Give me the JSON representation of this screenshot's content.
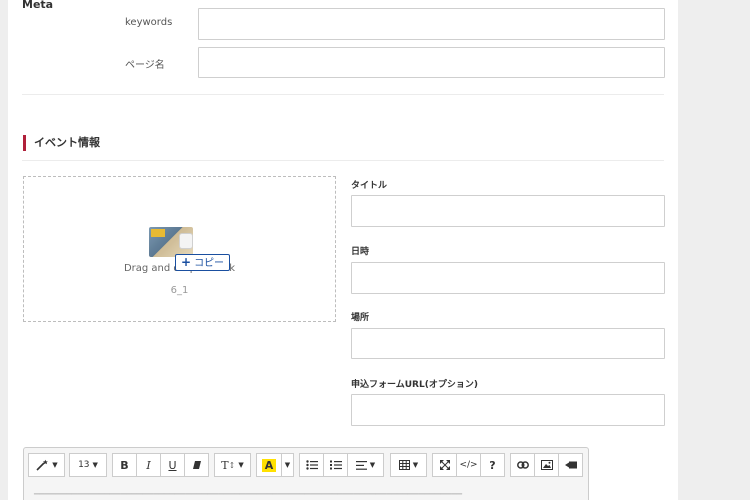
{
  "meta": {
    "section_label": "Meta",
    "keywords_label": "keywords",
    "page_name_label": "ページ名"
  },
  "event": {
    "section_title": "イベント情報",
    "accent_color": "#b0203a",
    "dropzone": {
      "text": "Drag and drop or click",
      "dragged_file_name": "6_1",
      "copy_badge": "コピー"
    },
    "fields": {
      "title_label": "タイトル",
      "datetime_label": "日時",
      "place_label": "場所",
      "form_url_label": "申込フォームURL(オプション)"
    }
  },
  "editor": {
    "font_size": "13",
    "bold": "B",
    "italic": "I",
    "underline": "U",
    "text_style": "T",
    "highlight": "A",
    "help": "?",
    "code": "</>"
  }
}
